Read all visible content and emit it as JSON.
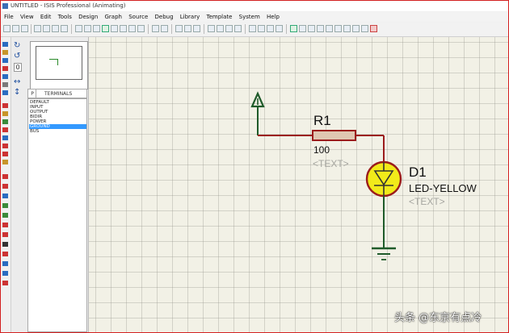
{
  "window": {
    "title": "UNTITLED - ISIS Professional (Animating)"
  },
  "menu": [
    "File",
    "View",
    "Edit",
    "Tools",
    "Design",
    "Graph",
    "Source",
    "Debug",
    "Library",
    "Template",
    "System",
    "Help"
  ],
  "panel": {
    "mode_letter": "P",
    "header": "TERMINALS",
    "items": [
      "DEFAULT",
      "INPUT",
      "OUTPUT",
      "BIDIR",
      "POWER",
      "GROUND",
      "BUS"
    ],
    "selected_index": 5
  },
  "schematic": {
    "resistor": {
      "ref": "R1",
      "value": "100",
      "text": "<TEXT>"
    },
    "led": {
      "ref": "D1",
      "value": "LED-YELLOW",
      "text": "<TEXT>"
    }
  },
  "colors": {
    "wire": "#9b1c1c",
    "terminal": "#1f5b2a",
    "led_fill": "#f1ea1a",
    "canvas": "#f2f1e6",
    "resistor_fill": "#e0c7b2"
  },
  "watermark": "头条 @东京有点冷"
}
